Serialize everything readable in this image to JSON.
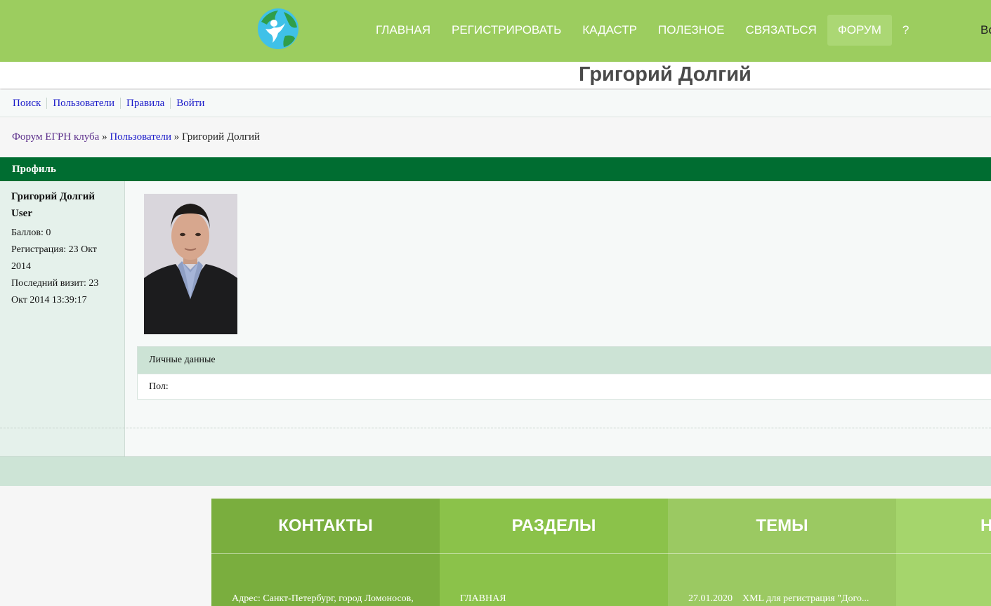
{
  "header": {
    "nav": [
      {
        "label": "ГЛАВНАЯ",
        "active": false
      },
      {
        "label": "РЕГИСТРИРОВАТЬ",
        "active": false
      },
      {
        "label": "КАДАСТР",
        "active": false
      },
      {
        "label": "ПОЛЕЗНОЕ",
        "active": false
      },
      {
        "label": "СВЯЗАТЬСЯ",
        "active": false
      },
      {
        "label": "ФОРУМ",
        "active": true
      },
      {
        "label": "?",
        "active": false
      }
    ],
    "cut_text": "Во"
  },
  "page_title": "Григорий Долгий",
  "forum_nav": [
    "Поиск",
    "Пользователи",
    "Правила",
    "Войти"
  ],
  "breadcrumb": {
    "forum": "Форум ЕГРН клуба",
    "sep": " » ",
    "users": "Пользователи",
    "current": "Григорий Долгий"
  },
  "profile": {
    "section_title": "Профиль",
    "name": "Григорий Долгий",
    "role": "User",
    "points": "Баллов: 0",
    "registered": "Регистрация: 23 Окт 2014",
    "last_visit": "Последний визит: 23 Окт 2014 13:39:17",
    "personal_title": "Личные данные",
    "gender_label": "Пол:"
  },
  "footer": {
    "columns": [
      {
        "title": "КОНТАКТЫ",
        "text": "Адрес: Санкт-Петербург, город Ломоносов,",
        "color": "#7aae3e"
      },
      {
        "title": "РАЗДЕЛЫ",
        "text": "ГЛАВНАЯ",
        "color": "#8bc24a"
      },
      {
        "title": "ТЕМЫ",
        "text": "27.01.2020    XML для регистрация \"Дого...",
        "color": "#9bc962"
      },
      {
        "title": "Н",
        "text": "",
        "color": "#a5d56c"
      }
    ]
  },
  "colors": {
    "header_bg": "#9ccd5f",
    "profile_header": "#006d31",
    "link": "#1a1ac9"
  }
}
